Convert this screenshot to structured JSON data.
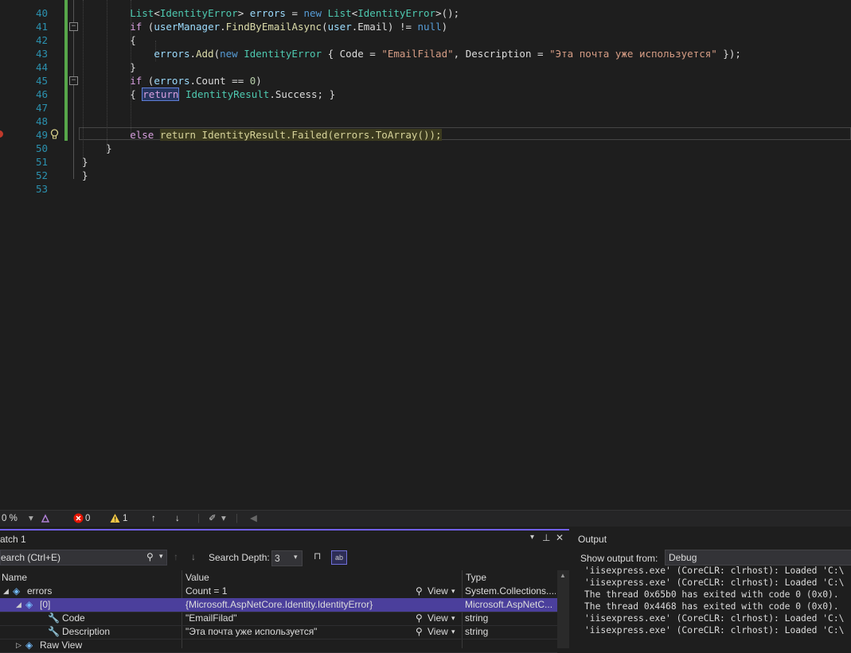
{
  "editor": {
    "lines": [
      {
        "n": "40",
        "segments": [
          {
            "t": "        ",
            "c": ""
          },
          {
            "t": "List",
            "c": "t-cls"
          },
          {
            "t": "<",
            "c": ""
          },
          {
            "t": "IdentityError",
            "c": "t-cls"
          },
          {
            "t": "> ",
            "c": ""
          },
          {
            "t": "errors",
            "c": "t-var"
          },
          {
            "t": " = ",
            "c": ""
          },
          {
            "t": "new",
            "c": "t-kw"
          },
          {
            "t": " ",
            "c": ""
          },
          {
            "t": "List",
            "c": "t-cls"
          },
          {
            "t": "<",
            "c": ""
          },
          {
            "t": "IdentityError",
            "c": "t-cls"
          },
          {
            "t": ">();",
            "c": ""
          }
        ]
      },
      {
        "n": "41",
        "segments": [
          {
            "t": "        ",
            "c": ""
          },
          {
            "t": "if",
            "c": "t-ctl"
          },
          {
            "t": " (",
            "c": ""
          },
          {
            "t": "userManager",
            "c": "t-var"
          },
          {
            "t": ".",
            "c": ""
          },
          {
            "t": "FindByEmailAsync",
            "c": "t-mth"
          },
          {
            "t": "(",
            "c": ""
          },
          {
            "t": "user",
            "c": "t-var"
          },
          {
            "t": ".Email) != ",
            "c": ""
          },
          {
            "t": "null",
            "c": "t-kw"
          },
          {
            "t": ")",
            "c": ""
          }
        ]
      },
      {
        "n": "42",
        "segments": [
          {
            "t": "        {",
            "c": ""
          }
        ]
      },
      {
        "n": "43",
        "segments": [
          {
            "t": "            ",
            "c": ""
          },
          {
            "t": "errors",
            "c": "t-var"
          },
          {
            "t": ".",
            "c": ""
          },
          {
            "t": "Add",
            "c": "t-mth"
          },
          {
            "t": "(",
            "c": ""
          },
          {
            "t": "new",
            "c": "t-kw"
          },
          {
            "t": " ",
            "c": ""
          },
          {
            "t": "IdentityError",
            "c": "t-cls"
          },
          {
            "t": " { Code = ",
            "c": ""
          },
          {
            "t": "\"EmailFilad\"",
            "c": "t-str"
          },
          {
            "t": ", Description = ",
            "c": ""
          },
          {
            "t": "\"Эта почта уже используется\"",
            "c": "t-str"
          },
          {
            "t": " });",
            "c": ""
          }
        ]
      },
      {
        "n": "44",
        "segments": [
          {
            "t": "        }",
            "c": ""
          }
        ]
      },
      {
        "n": "45",
        "segments": [
          {
            "t": "        ",
            "c": ""
          },
          {
            "t": "if",
            "c": "t-ctl"
          },
          {
            "t": " (",
            "c": ""
          },
          {
            "t": "errors",
            "c": "t-var"
          },
          {
            "t": ".Count == ",
            "c": ""
          },
          {
            "t": "0",
            "c": "t-num"
          },
          {
            "t": ")",
            "c": ""
          }
        ]
      },
      {
        "n": "46",
        "segments": [
          {
            "t": "        { ",
            "c": ""
          },
          {
            "t": "return",
            "c": "t-ctl ret-box"
          },
          {
            "t": " ",
            "c": ""
          },
          {
            "t": "IdentityResult",
            "c": "t-cls"
          },
          {
            "t": ".Success; }",
            "c": ""
          }
        ]
      },
      {
        "n": "47",
        "segments": []
      },
      {
        "n": "48",
        "segments": []
      },
      {
        "n": "49",
        "segments": [
          {
            "t": "        ",
            "c": ""
          },
          {
            "t": "else",
            "c": "t-ctl"
          },
          {
            "t": " ",
            "c": ""
          },
          {
            "t": "return IdentityResult.Failed(errors.ToArray());",
            "c": "hl-yellow"
          }
        ]
      },
      {
        "n": "50",
        "segments": [
          {
            "t": "    }",
            "c": ""
          }
        ]
      },
      {
        "n": "51",
        "segments": [
          {
            "t": "}",
            "c": ""
          }
        ]
      },
      {
        "n": "52",
        "segments": [
          {
            "t": "}",
            "c": ""
          }
        ]
      },
      {
        "n": "53",
        "segments": []
      }
    ]
  },
  "status": {
    "zoom": "0 %",
    "errors": "0",
    "warnings": "1"
  },
  "watch": {
    "title": "atch 1",
    "search_placeholder": "earch (Ctrl+E)",
    "depth_label": "Search Depth:",
    "depth_value": "3",
    "columns": {
      "name": "Name",
      "value": "Value",
      "type": "Type"
    },
    "rows": [
      {
        "name": "errors",
        "value": "Count = 1",
        "view": "View",
        "type": "System.Collections...."
      },
      {
        "name": "[0]",
        "value": "{Microsoft.AspNetCore.Identity.IdentityError}",
        "view": "",
        "type": "Microsoft.AspNetC..."
      },
      {
        "name": "Code",
        "value": "\"EmailFilad\"",
        "view": "View",
        "type": "string"
      },
      {
        "name": "Description",
        "value": "\"Эта почта уже используется\"",
        "view": "View",
        "type": "string"
      },
      {
        "name": "Raw View",
        "value": "",
        "view": "",
        "type": ""
      }
    ]
  },
  "output": {
    "title": "Output",
    "show_from_label": "Show output from:",
    "source": "Debug",
    "lines": [
      "'iisexpress.exe' (CoreCLR: clrhost): Loaded 'C:\\",
      "'iisexpress.exe' (CoreCLR: clrhost): Loaded 'C:\\",
      "The thread 0x65b0 has exited with code 0 (0x0).",
      "The thread 0x4468 has exited with code 0 (0x0).",
      "'iisexpress.exe' (CoreCLR: clrhost): Loaded 'C:\\",
      "'iisexpress.exe' (CoreCLR: clrhost): Loaded 'C:\\"
    ]
  },
  "colors": {
    "accent": "#7160e8",
    "selected_row": "#4b3f9c",
    "line_numbers": "#2b91af",
    "change_bar": "#57a64a"
  }
}
